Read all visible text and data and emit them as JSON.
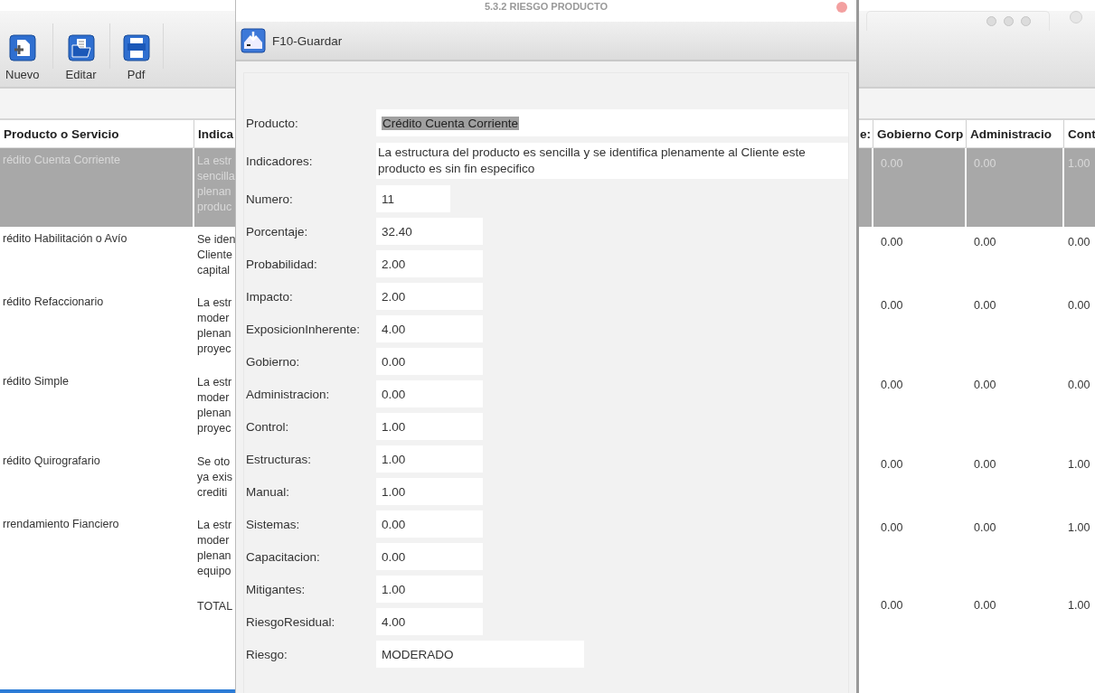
{
  "toolbar": {
    "buttons": [
      {
        "label": "Nuevo"
      },
      {
        "label": "Editar"
      },
      {
        "label": "Pdf"
      }
    ]
  },
  "table": {
    "columns": [
      "Producto o Servicio",
      "Indica",
      "e:",
      "Gobierno Corp",
      "Administracio",
      "Cont"
    ],
    "rows": [
      {
        "selected": true,
        "product": "rédito Cuenta Corriente",
        "indicator_lines": [
          "La estr",
          "sencilla",
          "plenan",
          "produc"
        ],
        "values": [
          "0.00",
          "0.00",
          "1.00"
        ]
      },
      {
        "selected": false,
        "product": "rédito Habilitación o Avío",
        "indicator_lines": [
          "Se iden",
          "Cliente",
          "capital"
        ],
        "values": [
          "0.00",
          "0.00",
          "0.00"
        ]
      },
      {
        "selected": false,
        "product": "rédito Refaccionario",
        "indicator_lines": [
          "La estr",
          "moder",
          "plenan",
          "proyec"
        ],
        "values": [
          "0.00",
          "0.00",
          "0.00"
        ]
      },
      {
        "selected": false,
        "product": "rédito Simple",
        "indicator_lines": [
          "La estr",
          "moder",
          "plenan",
          "proyec"
        ],
        "values": [
          "0.00",
          "0.00",
          "0.00"
        ]
      },
      {
        "selected": false,
        "product": "rédito Quirografario",
        "indicator_lines": [
          "Se oto",
          "ya exis",
          "crediti"
        ],
        "values": [
          "0.00",
          "0.00",
          "1.00"
        ]
      },
      {
        "selected": false,
        "product": "rrendamiento Fianciero",
        "indicator_lines": [
          "La estr",
          "moder",
          "plenan",
          "equipo"
        ],
        "values": [
          "0.00",
          "0.00",
          "1.00"
        ]
      },
      {
        "selected": false,
        "indicator_lines": [
          "TOTAL"
        ],
        "values": [
          "0.00",
          "0.00",
          "1.00"
        ]
      }
    ]
  },
  "dialog": {
    "title": "5.3.2 RIESGO PRODUCTO",
    "save_button": "F10-Guardar",
    "fields": [
      {
        "label": "Producto:",
        "value": "Crédito Cuenta Corriente",
        "kind": "wide",
        "selected": true
      },
      {
        "label": "Indicadores:",
        "value": "La estructura del producto es sencilla y se identifica plenamente al Cliente este producto es sin fin especifico",
        "kind": "multiline",
        "selected": false
      },
      {
        "label": "Numero:",
        "value": "11",
        "kind": "short",
        "selected": false
      },
      {
        "label": "Porcentaje:",
        "value": "32.40",
        "kind": "medium",
        "selected": false
      },
      {
        "label": "Probabilidad:",
        "value": "2.00",
        "kind": "medium",
        "selected": false
      },
      {
        "label": "Impacto:",
        "value": "2.00",
        "kind": "medium",
        "selected": false
      },
      {
        "label": "ExposicionInherente:",
        "value": "4.00",
        "kind": "medium",
        "selected": false
      },
      {
        "label": "Gobierno:",
        "value": "0.00",
        "kind": "medium",
        "selected": false
      },
      {
        "label": "Administracion:",
        "value": "0.00",
        "kind": "medium",
        "selected": false
      },
      {
        "label": "Control:",
        "value": "1.00",
        "kind": "medium",
        "selected": false
      },
      {
        "label": "Estructuras:",
        "value": "1.00",
        "kind": "medium",
        "selected": false
      },
      {
        "label": "Manual:",
        "value": "1.00",
        "kind": "medium",
        "selected": false
      },
      {
        "label": "Sistemas:",
        "value": "0.00",
        "kind": "medium",
        "selected": false
      },
      {
        "label": "Capacitacion:",
        "value": "0.00",
        "kind": "medium",
        "selected": false
      },
      {
        "label": "Mitigantes:",
        "value": "1.00",
        "kind": "medium",
        "selected": false
      },
      {
        "label": "RiesgoResidual:",
        "value": "4.00",
        "kind": "medium",
        "selected": false
      },
      {
        "label": "Riesgo:",
        "value": "MODERADO",
        "kind": "long",
        "selected": false
      }
    ]
  }
}
